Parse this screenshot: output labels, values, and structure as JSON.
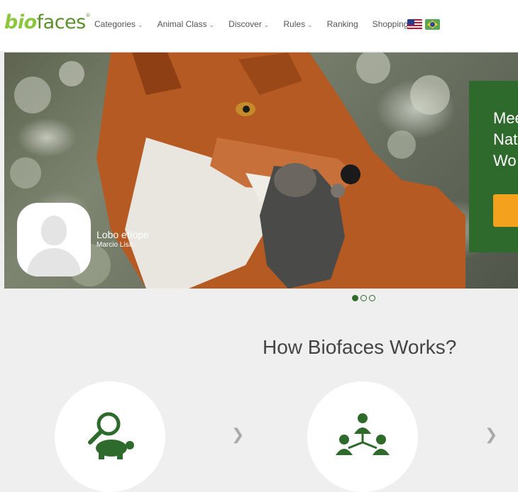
{
  "header": {
    "logo_bio": "bio",
    "logo_faces": "faces",
    "logo_mark": "®",
    "nav": [
      {
        "label": "Categories",
        "dropdown": true
      },
      {
        "label": "Animal Class",
        "dropdown": true
      },
      {
        "label": "Discover",
        "dropdown": true
      },
      {
        "label": "Rules",
        "dropdown": true
      },
      {
        "label": "Ranking",
        "dropdown": false
      },
      {
        "label": "Shopping",
        "dropdown": false
      }
    ],
    "chevron": "⌄",
    "languages": [
      "us-flag",
      "br-flag"
    ]
  },
  "hero": {
    "photo_title": "Lobo etíope",
    "photo_author": "Marcio Lisa",
    "card_lines": [
      "Mee",
      "Nat",
      "Wo"
    ],
    "slide_count": 3,
    "active_slide": 1
  },
  "how_it_works": {
    "title": "How Biofaces Works?",
    "steps": [
      {
        "icon": "magnifier-turtle-icon"
      },
      {
        "icon": "community-network-icon"
      }
    ],
    "arrow": "❯"
  },
  "colors": {
    "brand_green": "#2f6a2d",
    "logo_light": "#8cc63f",
    "logo_dark": "#5a8f2a",
    "cta_orange": "#f4a21e",
    "background": "#efefef"
  }
}
